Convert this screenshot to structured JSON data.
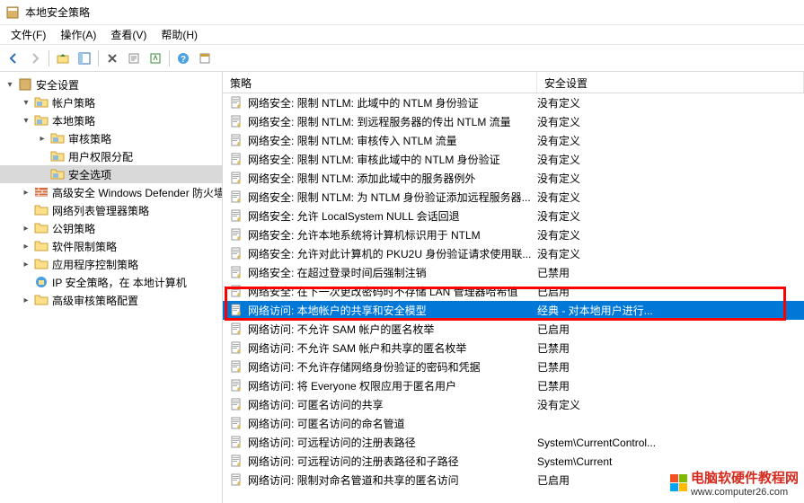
{
  "window": {
    "title": "本地安全策略"
  },
  "menu": {
    "file": "文件(F)",
    "action": "操作(A)",
    "view": "查看(V)",
    "help": "帮助(H)"
  },
  "tree": {
    "root": "安全设置",
    "items": [
      {
        "label": "帐户策略",
        "expanded": true,
        "depth": 1,
        "icon": "folder"
      },
      {
        "label": "本地策略",
        "expanded": true,
        "depth": 1,
        "icon": "folder"
      },
      {
        "label": "审核策略",
        "expanded": false,
        "depth": 2,
        "icon": "folder"
      },
      {
        "label": "用户权限分配",
        "expanded": null,
        "depth": 2,
        "icon": "folder"
      },
      {
        "label": "安全选项",
        "expanded": null,
        "depth": 2,
        "icon": "folder",
        "selected": true
      },
      {
        "label": "高级安全 Windows Defender 防火墙",
        "expanded": false,
        "depth": 1,
        "icon": "wall"
      },
      {
        "label": "网络列表管理器策略",
        "expanded": null,
        "depth": 1,
        "icon": "folder-plain"
      },
      {
        "label": "公钥策略",
        "expanded": false,
        "depth": 1,
        "icon": "folder-plain"
      },
      {
        "label": "软件限制策略",
        "expanded": false,
        "depth": 1,
        "icon": "folder-plain"
      },
      {
        "label": "应用程序控制策略",
        "expanded": false,
        "depth": 1,
        "icon": "folder-plain"
      },
      {
        "label": "IP 安全策略，在 本地计算机",
        "expanded": null,
        "depth": 1,
        "icon": "ipsec"
      },
      {
        "label": "高级审核策略配置",
        "expanded": false,
        "depth": 1,
        "icon": "folder-plain"
      }
    ]
  },
  "list": {
    "cols": {
      "policy": "策略",
      "setting": "安全设置"
    },
    "rows": [
      {
        "policy": "网络安全: 限制 NTLM: 此域中的 NTLM 身份验证",
        "setting": "没有定义"
      },
      {
        "policy": "网络安全: 限制 NTLM: 到远程服务器的传出 NTLM 流量",
        "setting": "没有定义"
      },
      {
        "policy": "网络安全: 限制 NTLM: 审核传入 NTLM 流量",
        "setting": "没有定义"
      },
      {
        "policy": "网络安全: 限制 NTLM: 审核此域中的 NTLM 身份验证",
        "setting": "没有定义"
      },
      {
        "policy": "网络安全: 限制 NTLM: 添加此域中的服务器例外",
        "setting": "没有定义"
      },
      {
        "policy": "网络安全: 限制 NTLM: 为 NTLM 身份验证添加远程服务器...",
        "setting": "没有定义"
      },
      {
        "policy": "网络安全: 允许 LocalSystem NULL 会话回退",
        "setting": "没有定义"
      },
      {
        "policy": "网络安全: 允许本地系统将计算机标识用于 NTLM",
        "setting": "没有定义"
      },
      {
        "policy": "网络安全: 允许对此计算机的 PKU2U 身份验证请求使用联...",
        "setting": "没有定义"
      },
      {
        "policy": "网络安全: 在超过登录时间后强制注销",
        "setting": "已禁用"
      },
      {
        "policy": "网络安全: 在下一次更改密码时不存储 LAN 管理器哈希值",
        "setting": "已启用"
      },
      {
        "policy": "网络访问: 本地帐户的共享和安全模型",
        "setting": "经典 - 对本地用户进行...",
        "selected": true
      },
      {
        "policy": "网络访问: 不允许 SAM 帐户的匿名枚举",
        "setting": "已启用"
      },
      {
        "policy": "网络访问: 不允许 SAM 帐户和共享的匿名枚举",
        "setting": "已禁用"
      },
      {
        "policy": "网络访问: 不允许存储网络身份验证的密码和凭据",
        "setting": "已禁用"
      },
      {
        "policy": "网络访问: 将 Everyone 权限应用于匿名用户",
        "setting": "已禁用"
      },
      {
        "policy": "网络访问: 可匿名访问的共享",
        "setting": "没有定义"
      },
      {
        "policy": "网络访问: 可匿名访问的命名管道",
        "setting": ""
      },
      {
        "policy": "网络访问: 可远程访问的注册表路径",
        "setting": "System\\CurrentControl..."
      },
      {
        "policy": "网络访问: 可远程访问的注册表路径和子路径",
        "setting": "System\\Current"
      },
      {
        "policy": "网络访问: 限制对命名管道和共享的匿名访问",
        "setting": "已启用"
      }
    ]
  },
  "watermark": {
    "line1": "电脑软硬件教程网",
    "line2": "www.computer26.com"
  }
}
